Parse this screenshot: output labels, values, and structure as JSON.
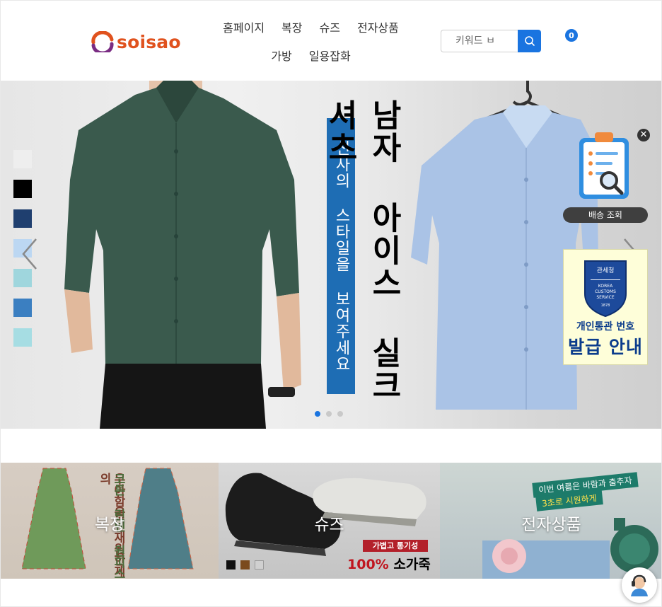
{
  "brand": {
    "logo_text": "soisao"
  },
  "nav": {
    "row1": [
      "홈페이지",
      "복장",
      "슈즈",
      "전자상품"
    ],
    "row2": [
      "가방",
      "일용잡화"
    ]
  },
  "search": {
    "placeholder": "키워드 ㅂ",
    "icon": "search-icon"
  },
  "cart": {
    "count": "0"
  },
  "banner": {
    "title_vertical": "남자 아이스 실크 셔츠",
    "subtitle_vertical": "신사의 스타일을 보여주세요",
    "swatch_colors": [
      "#eeeeee",
      "#000000",
      "#1f3f6f",
      "#bcd7f2",
      "#9fd6dd",
      "#3b7fc1",
      "#a6dde3"
    ],
    "slides_total": 3,
    "slide_active": 1
  },
  "delivery_widget": {
    "label": "배송 조회",
    "close": "✕"
  },
  "customs_widget": {
    "seal_top": "관세청",
    "seal_lines": [
      "KOREA",
      "CUSTOMS",
      "SERVICE",
      "1878"
    ],
    "line1": "개인통관 번호",
    "line2": "발급 안내"
  },
  "categories": [
    {
      "label": "복장",
      "art_text_left": "우아함을 재원한제의",
      "art_text_right": "코튼 린넨 원피스"
    },
    {
      "label": "슈즈",
      "tag": "가볍고 통기성",
      "headline_red": "100%",
      "headline_black": " 소가죽",
      "swatches": [
        "#111111",
        "#7b4a1d",
        "#d0d0d0"
      ]
    },
    {
      "label": "전자상품",
      "banner1": "이번 여름은 바람과 춤추자",
      "banner2": "3초로 시원하게"
    }
  ],
  "colors": {
    "accent": "#1a74e0",
    "logo_orange": "#e0521e",
    "logo_purple": "#7a2c83",
    "banner_blue": "#1e6db4"
  }
}
